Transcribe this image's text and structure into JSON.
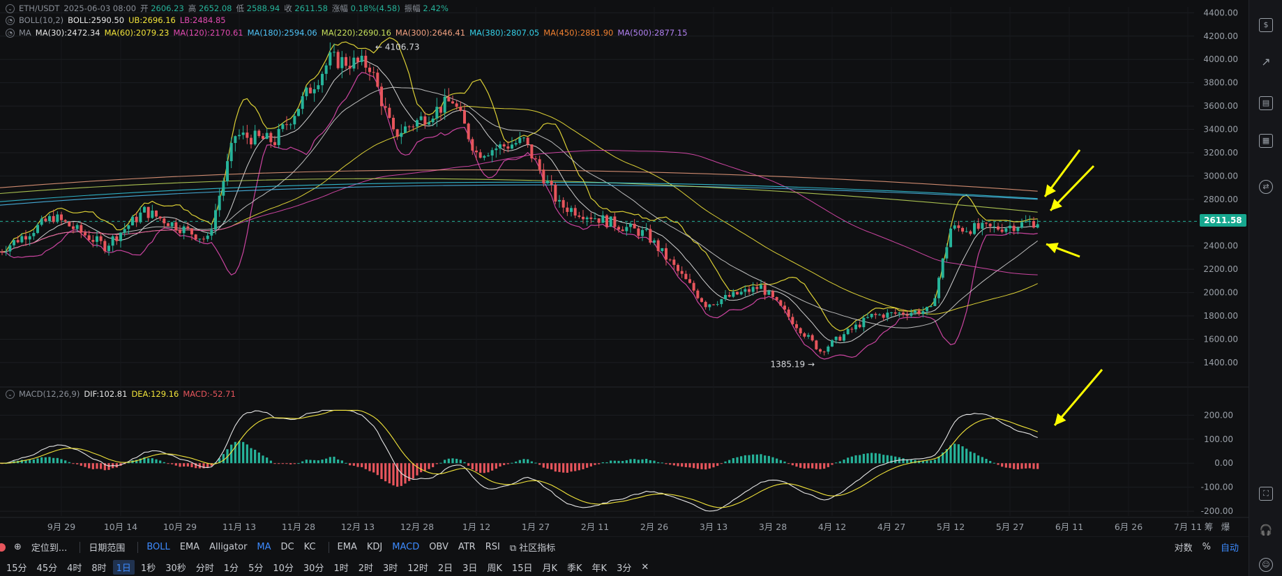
{
  "header": {
    "symbol": "ETH/USDT",
    "datetime": "2025-06-03 08:00",
    "open_label": "开",
    "open": "2606.23",
    "high_label": "高",
    "high": "2652.08",
    "low_label": "低",
    "low": "2588.94",
    "close_label": "收",
    "close": "2611.58",
    "change_label": "涨幅",
    "change": "0.18%(4.58)",
    "amp_label": "振幅",
    "amp": "2.42%"
  },
  "boll": {
    "name": "BOLL(10,2)",
    "mid": "BOLL:2590.50",
    "ub": "UB:2696.16",
    "lb": "LB:2484.85"
  },
  "ma": {
    "name": "MA",
    "items": [
      {
        "text": "MA(30):2472.34",
        "color": "#e6e6e6"
      },
      {
        "text": "MA(60):2079.23",
        "color": "#f2e43a"
      },
      {
        "text": "MA(120):2170.61",
        "color": "#e04ab0"
      },
      {
        "text": "MA(180):2594.06",
        "color": "#4fc3f7"
      },
      {
        "text": "MA(220):2690.16",
        "color": "#c6e05c"
      },
      {
        "text": "MA(300):2646.41",
        "color": "#f0a080"
      },
      {
        "text": "MA(380):2807.05",
        "color": "#35d0e8"
      },
      {
        "text": "MA(450):2881.90",
        "color": "#f08030"
      },
      {
        "text": "MA(500):2877.15",
        "color": "#b080f0"
      }
    ]
  },
  "macd": {
    "name": "MACD(12,26,9)",
    "dif": "DIF:102.81",
    "dea": "DEA:129.16",
    "macd": "MACD:-52.71"
  },
  "price_tag": "2611.58",
  "annotations": {
    "high_label": "4106.73",
    "low_label": "1385.19"
  },
  "toolbar": {
    "locate": "定位到...",
    "range": "日期范围",
    "main_indicators": [
      "BOLL",
      "EMA",
      "Alligator",
      "MA",
      "DC",
      "KC"
    ],
    "sub_indicators": [
      "EMA",
      "KDJ",
      "MACD",
      "OBV",
      "ATR",
      "RSI"
    ],
    "community": "社区指标",
    "log": "对数",
    "pct": "%",
    "auto": "自动"
  },
  "timeframes": [
    "15分",
    "45分",
    "4时",
    "8时",
    "1日",
    "1秒",
    "30秒",
    "分时",
    "1分",
    "5分",
    "10分",
    "30分",
    "1时",
    "2时",
    "3时",
    "12时",
    "2日",
    "3日",
    "周K",
    "15日",
    "月K",
    "季K",
    "年K",
    "3分",
    "✕"
  ],
  "selected_timeframe": "1日",
  "colors": {
    "up": "#26b39a",
    "down": "#e7555c",
    "arrow": "#ffff00",
    "background": "#0f1012"
  },
  "chart_data": {
    "type": "candlestick",
    "title": "ETH/USDT",
    "price_axis": {
      "ticks": [
        1400,
        1600,
        1800,
        2000,
        2200,
        2400,
        2600,
        2800,
        3000,
        3200,
        3400,
        3600,
        3800,
        4000,
        4200,
        4400
      ],
      "ylim": [
        1250,
        4450
      ]
    },
    "macd_axis": {
      "ticks": [
        -200,
        -100,
        0,
        100,
        200
      ],
      "ylim": [
        -220,
        230
      ]
    },
    "x_ticks": [
      "9月 29",
      "10月 14",
      "10月 29",
      "11月 13",
      "11月 28",
      "12月 13",
      "12月 28",
      "1月 12",
      "1月 27",
      "2月 11",
      "2月 26",
      "3月 13",
      "3月 28",
      "4月 12",
      "4月 27",
      "5月 12",
      "5月 27",
      "6月 11",
      "6月 26",
      "7月 11"
    ],
    "x_extra": [
      "筹",
      "爆"
    ],
    "close_path": [
      {
        "date": "2024-09-13",
        "close": 2350
      },
      {
        "date": "2024-09-27",
        "close": 2650
      },
      {
        "date": "2024-10-10",
        "close": 2400
      },
      {
        "date": "2024-10-20",
        "close": 2700
      },
      {
        "date": "2024-11-05",
        "close": 2450
      },
      {
        "date": "2024-11-12",
        "close": 3350
      },
      {
        "date": "2024-11-22",
        "close": 3300
      },
      {
        "date": "2024-12-06",
        "close": 4000
      },
      {
        "date": "2024-12-16",
        "close": 3950
      },
      {
        "date": "2024-12-22",
        "close": 3350
      },
      {
        "date": "2025-01-06",
        "close": 3650
      },
      {
        "date": "2025-01-12",
        "close": 3200
      },
      {
        "date": "2025-01-24",
        "close": 3300
      },
      {
        "date": "2025-02-02",
        "close": 2750
      },
      {
        "date": "2025-02-24",
        "close": 2500
      },
      {
        "date": "2025-03-11",
        "close": 1900
      },
      {
        "date": "2025-03-25",
        "close": 2050
      },
      {
        "date": "2025-04-09",
        "close": 1500
      },
      {
        "date": "2025-04-22",
        "close": 1800
      },
      {
        "date": "2025-05-07",
        "close": 1850
      },
      {
        "date": "2025-05-12",
        "close": 2550
      },
      {
        "date": "2025-05-23",
        "close": 2550
      },
      {
        "date": "2025-06-03",
        "close": 2611.58
      }
    ]
  }
}
